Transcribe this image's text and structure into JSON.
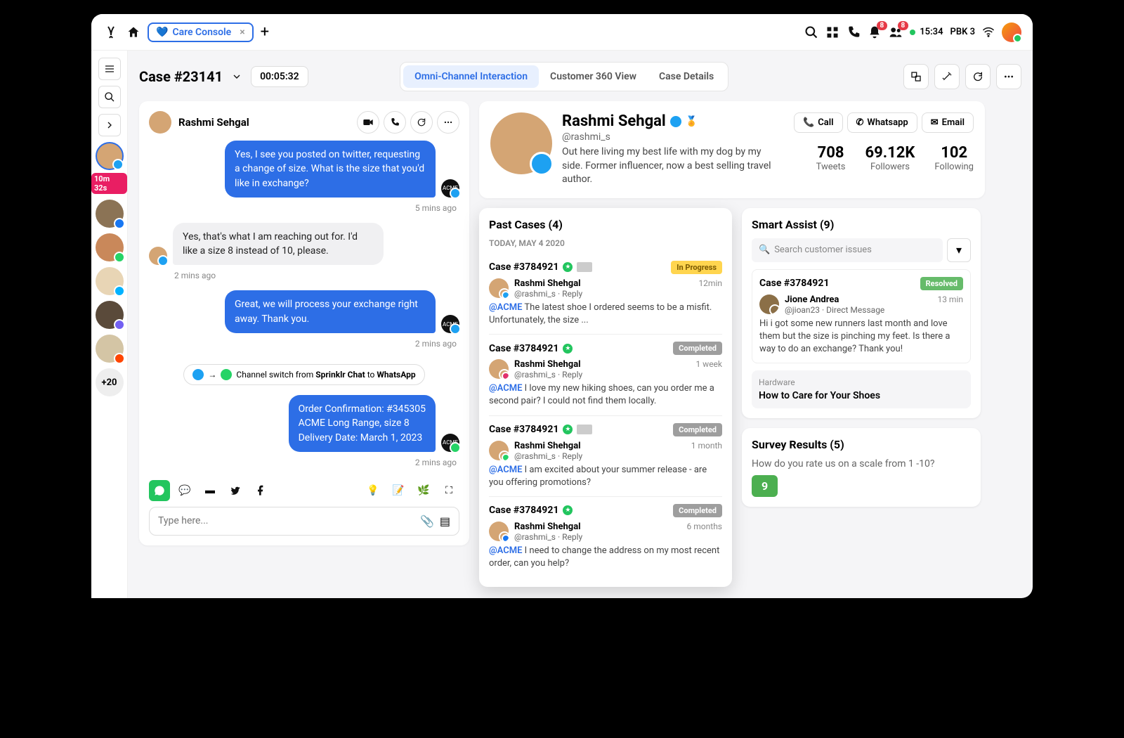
{
  "topbar": {
    "tab_label": "Care Console",
    "time": "15:34",
    "network": "PBK 3"
  },
  "rail": {
    "active_timer": "10m 32s",
    "more": "+20"
  },
  "header": {
    "case_title": "Case #23141",
    "timer": "00:05:32",
    "tabs": {
      "omni": "Omni-Channel Interaction",
      "c360": "Customer 360 View",
      "details": "Case Details"
    }
  },
  "chat": {
    "name": "Rashmi Sehgal",
    "m1": "Yes, I see you posted on twitter, requesting a change of size. What is the size that you'd like in exchange?",
    "t1": "5 mins ago",
    "m2": "Yes, that's what I am reaching out for. I'd like a size 8 instead of 10, please.",
    "t2": "2 mins ago",
    "m3": "Great, we will process your exchange right away. Thank you.",
    "t3": "2 mins ago",
    "switch_pre": "Channel switch from ",
    "switch_from": "Sprinklr Chat",
    "switch_mid": " to ",
    "switch_to": "WhatsApp",
    "m4a": "Order Confirmation: #345305",
    "m4b": "ACME Long Range, size 8",
    "m4c": "Delivery Date: March 1, 2023",
    "t4": "2 mins ago",
    "placeholder": "Type here..."
  },
  "profile": {
    "name": "Rashmi Sehgal",
    "handle": "@rashmi_s",
    "bio": "Out here living my best life with my dog by my side. Former influencer, now a best selling travel author.",
    "call": "Call",
    "whatsapp": "Whatsapp",
    "email": "Email",
    "tweets_n": "708",
    "tweets_l": "Tweets",
    "followers_n": "69.12K",
    "followers_l": "Followers",
    "following_n": "102",
    "following_l": "Following"
  },
  "past": {
    "title": "Past Cases (4)",
    "date": "TODAY, MAY 4 2020",
    "items": [
      {
        "id": "Case #3784921",
        "status": "In Progress",
        "status_cls": "st-prog",
        "name": "Rashmi Shehgal",
        "meta": "@rashmi_s · Reply",
        "time": "12min",
        "mention": "@ACME",
        "text": " The latest shoe I ordered seems to be a misfit. Unfortunately, the size ...",
        "thumb": true,
        "ch": "tw"
      },
      {
        "id": "Case #3784921",
        "status": "Completed",
        "status_cls": "st-comp",
        "name": "Rashmi Shehgal",
        "meta": "@rashmi_s · Reply",
        "time": "1 week",
        "mention": "@ACME",
        "text": " I love my new hiking shoes, can you order me a second pair? I could not find them locally.",
        "thumb": false,
        "ch": "ms"
      },
      {
        "id": "Case #3784921",
        "status": "Completed",
        "status_cls": "st-comp",
        "name": "Rashmi Shehgal",
        "meta": "@rashmi_s · Reply",
        "time": "1 month",
        "mention": "@ACME",
        "text": " I am excited about your summer release - are you offering promotions?",
        "thumb": true,
        "ch": "wa"
      },
      {
        "id": "Case #3784921",
        "status": "Completed",
        "status_cls": "st-comp",
        "name": "Rashmi Shehgal",
        "meta": "@rashmi_s · Reply",
        "time": "6 months",
        "mention": "@ACME",
        "text": " I need to change the address on my most recent order, can you help?",
        "thumb": false,
        "ch": "fb"
      }
    ]
  },
  "assist": {
    "title": "Smart Assist (9)",
    "search_ph": "Search customer issues",
    "card": {
      "id": "Case #3784921",
      "status": "Resolved",
      "name": "Jione Andrea",
      "meta": "@jioan23 · Direct Message",
      "time": "13 min",
      "text": "Hi i got some new runners last month and love them but the size is pinching my feet. Is there a way to do an exchange? Thank you!"
    },
    "tag_lbl": "Hardware",
    "tag_txt": "How to Care for Your Shoes"
  },
  "survey": {
    "title": "Survey Results (5)",
    "q": "How do you rate us on a scale from 1 -10?",
    "score": "9"
  }
}
